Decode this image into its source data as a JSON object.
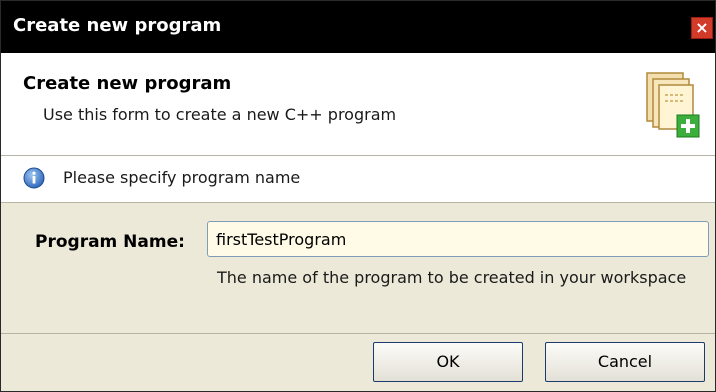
{
  "window": {
    "title": "Create new program",
    "close_glyph": "×",
    "close_icon": "close-icon"
  },
  "header": {
    "title": "Create new program",
    "subtitle": "Use this form to create a new C++ program",
    "icon": "new-document-plus-icon"
  },
  "message": {
    "icon": "info-icon",
    "text": "Please specify program name"
  },
  "form": {
    "program_name_label": "Program Name:",
    "program_name_value": "firstTestProgram",
    "program_name_help": "The name of the program to be created in your workspace"
  },
  "buttons": {
    "ok_label": "OK",
    "cancel_label": "Cancel"
  },
  "colors": {
    "titlebar": "#000000",
    "close_button": "#d23a2a",
    "dialog_bg": "#ece9d8",
    "input_bg": "#fffbe6",
    "plus_badge": "#3cae3c"
  }
}
